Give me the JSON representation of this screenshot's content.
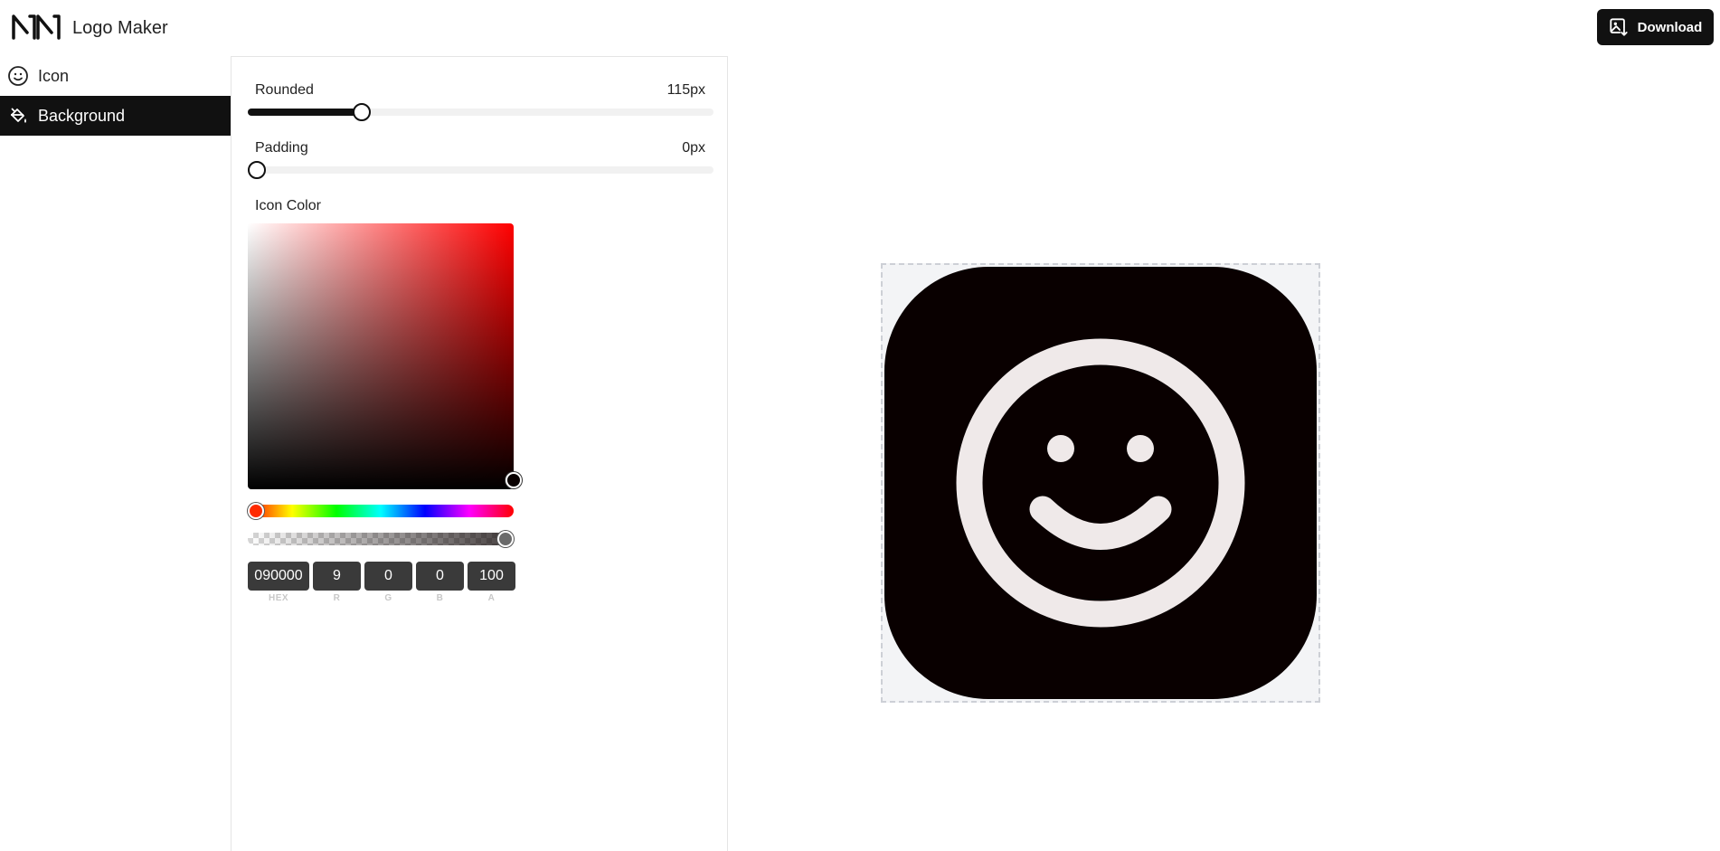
{
  "app": {
    "title": "Logo Maker",
    "download_label": "Download"
  },
  "sidebar": {
    "items": [
      {
        "label": "Icon",
        "icon": "smiley-icon",
        "active": false
      },
      {
        "label": "Background",
        "icon": "paint-bucket-icon",
        "active": true
      }
    ]
  },
  "panel": {
    "rounded": {
      "label": "Rounded",
      "value_text": "115px",
      "fraction": 0.235
    },
    "padding": {
      "label": "Padding",
      "value_text": "0px",
      "fraction": 0.0
    },
    "color": {
      "label": "Icon Color",
      "hex": "090000",
      "r": "9",
      "g": "0",
      "b": "0",
      "a": "100",
      "labels": {
        "hex": "HEX",
        "r": "R",
        "g": "G",
        "b": "B",
        "a": "A"
      },
      "hue_fraction": 0.0,
      "alpha_fraction": 1.0,
      "saturation_fraction": 1.0,
      "value_fraction": 0.035
    }
  },
  "preview": {
    "background_color": "#090000",
    "icon_color": "#efe9e9",
    "icon": "smiley-icon"
  }
}
